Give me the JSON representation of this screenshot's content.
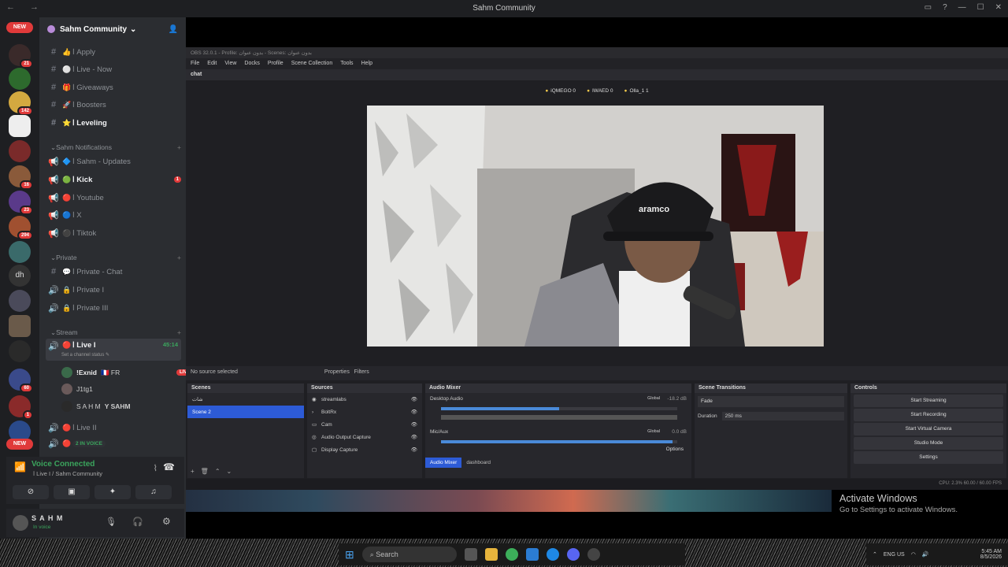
{
  "window": {
    "title": "Sahm Community"
  },
  "guild_rail": {
    "new_label": "NEW",
    "badges": [
      "21",
      "142",
      "16",
      "23",
      "294",
      "dh",
      "60",
      "8",
      "1"
    ]
  },
  "server": {
    "name": "Sahm Community"
  },
  "channels": [
    {
      "sym": "#",
      "emoji": "👍",
      "label": "ا Apply",
      "bright": false
    },
    {
      "sym": "#",
      "emoji": "⚪",
      "label": "ا Live - Now",
      "bright": false
    },
    {
      "sym": "#",
      "emoji": "🎁",
      "label": "ا Giveaways",
      "bright": false
    },
    {
      "sym": "#",
      "emoji": "🚀",
      "label": "ا Boosters",
      "bright": false
    },
    {
      "sym": "#",
      "emoji": "⭐",
      "label": "ا Leveling",
      "bright": true
    }
  ],
  "categories": {
    "notifications": "Sahm Notifications",
    "private": "Private",
    "stream": "Stream"
  },
  "notif_channels": [
    {
      "sym": "📢",
      "emoji": "🔷",
      "label": "ا Sahm - Updates",
      "bright": false
    },
    {
      "sym": "📢",
      "emoji": "🟢",
      "label": "ا Kick",
      "bright": true,
      "badge": "1"
    },
    {
      "sym": "📢",
      "emoji": "🔴",
      "label": "ا Youtube",
      "bright": false
    },
    {
      "sym": "📢",
      "emoji": "🔵",
      "label": "ا X",
      "bright": false
    },
    {
      "sym": "📢",
      "emoji": "⚫",
      "label": "ا Tiktok",
      "bright": false
    }
  ],
  "private_channels": [
    {
      "sym": "#",
      "emoji": "💬",
      "label": "ا Private - Chat"
    },
    {
      "sym": "🔊",
      "emoji": "🔒",
      "label": "ا Private I"
    },
    {
      "sym": "🔊",
      "emoji": "🔒",
      "label": "ا Private III"
    }
  ],
  "stream_live": {
    "label": "ا Live I",
    "time": "45:14",
    "status": "Set a channel status ✎"
  },
  "voice_users": [
    {
      "name": "!Exnid",
      "tag": "🇫🇷 FR",
      "live": "LIVE"
    },
    {
      "name": "J1tg1",
      "tag": "",
      "live": ""
    },
    {
      "name": "S A H M",
      "tag": "Y SAHM",
      "live": ""
    }
  ],
  "stream_live2": {
    "label": "ا Live II"
  },
  "stream_live3": {
    "label": "2 IN VOICE"
  },
  "voice_panel": {
    "status": "Voice Connected",
    "sub": "ا Live I / Sahm Community"
  },
  "user_panel": {
    "name": "S A H M",
    "status": "In voice"
  },
  "obs": {
    "title": "OBS 32.0.1 - Profile: بدون عنوان - Scenes: بدون عنوان",
    "menu": [
      "File",
      "Edit",
      "View",
      "Docks",
      "Profile",
      "Scene Collection",
      "Tools",
      "Help"
    ],
    "dock_title": "chat",
    "chat_users": [
      "iQMEGO 0",
      "IWAED 0",
      "Olla_1 1"
    ],
    "no_source": "No source selected",
    "properties": "Properties",
    "filters": "Filters",
    "scenes_head": "Scenes",
    "scenes": [
      "شات",
      "Scene 2"
    ],
    "sources_head": "Sources",
    "sources": [
      "streamlabs",
      "BoltRx",
      "Cam",
      "Audio Output Capture",
      "Display Capture"
    ],
    "mixer_head": "Audio Mixer",
    "mixer": [
      {
        "name": "Desktop Audio",
        "level": "-18.2 dB",
        "tag": "Global"
      },
      {
        "name": "Mic/Aux",
        "level": "0.0 dB",
        "tag": "Global"
      }
    ],
    "mixer_tabs": [
      "Audio Mixer",
      "dashboard"
    ],
    "options": "Options",
    "transitions_head": "Scene Transitions",
    "transition": "Fade",
    "duration_label": "Duration",
    "duration": "250 ms",
    "controls_head": "Controls",
    "controls": [
      "Start Streaming",
      "Start Recording",
      "Start Virtual Camera",
      "Studio Mode",
      "Settings"
    ],
    "status": "CPU: 2.3%   60.00 / 60.00 FPS"
  },
  "activate": {
    "line1": "Activate Windows",
    "line2": "Go to Settings to activate Windows."
  },
  "taskbar": {
    "search": "Search",
    "lang": "ENG US",
    "time": "5:45 AM",
    "date": "8/5/2026"
  }
}
